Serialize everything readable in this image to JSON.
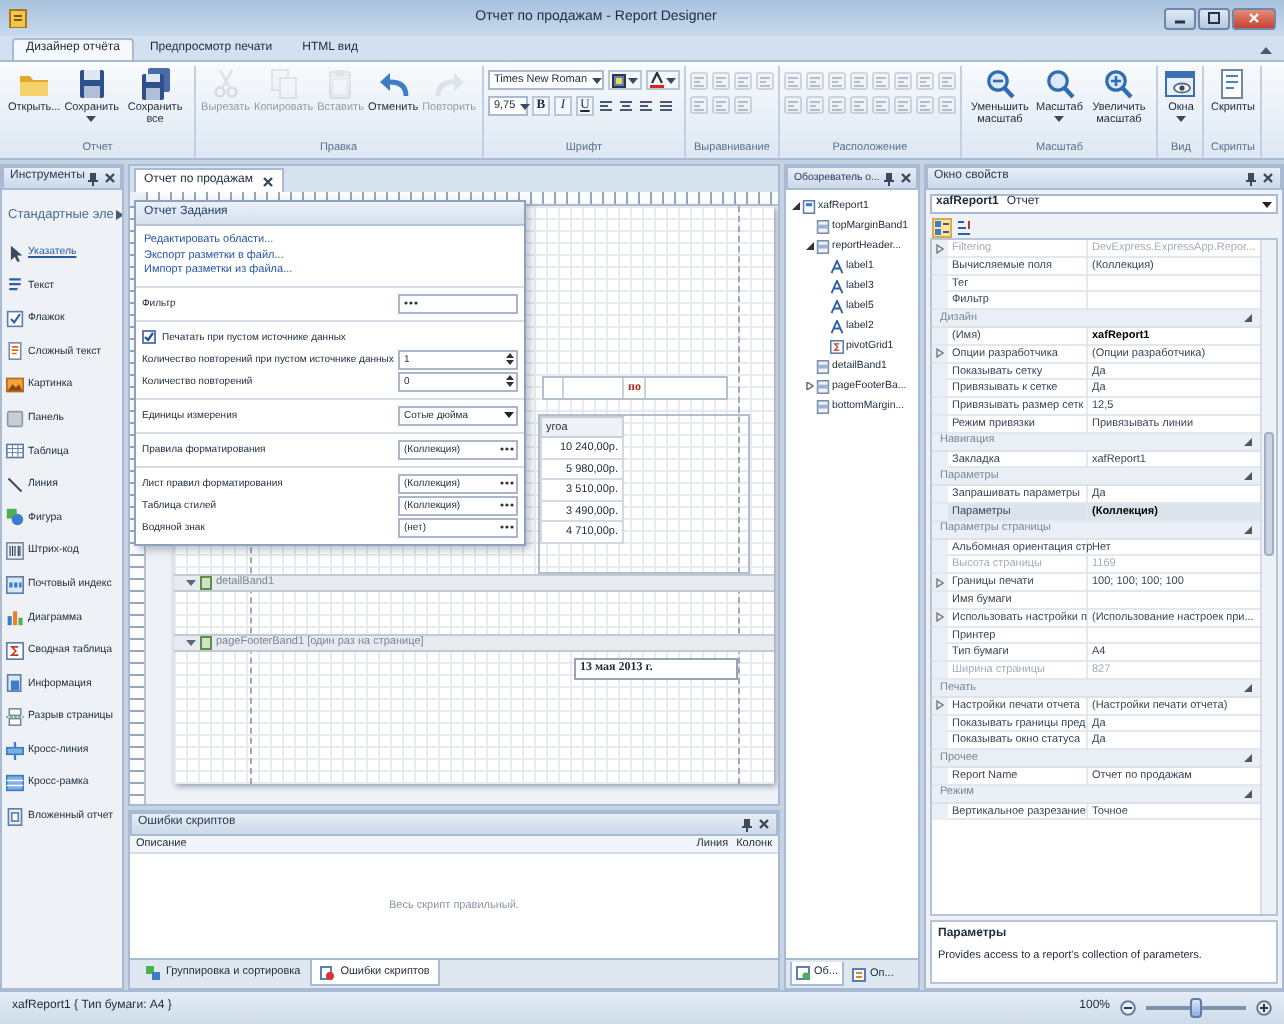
{
  "window": {
    "title": "Отчет по продажам - Report Designer"
  },
  "ribbon": {
    "tabs": [
      {
        "label": "Дизайнер отчёта",
        "selected": true
      },
      {
        "label": "Предпросмотр печати",
        "selected": false
      },
      {
        "label": "HTML вид",
        "selected": false
      }
    ],
    "groups": [
      {
        "label": "Отчет",
        "kind": "buttons",
        "buttons": [
          {
            "label": "Открыть...",
            "disabled": false,
            "dropdown": false
          },
          {
            "label": "Сохранить",
            "disabled": false,
            "dropdown": true
          },
          {
            "label": "Сохранить все",
            "disabled": false,
            "dropdown": false
          }
        ]
      },
      {
        "label": "Правка",
        "kind": "buttons",
        "buttons": [
          {
            "label": "Вырезать",
            "disabled": true,
            "dropdown": false
          },
          {
            "label": "Копировать",
            "disabled": true,
            "dropdown": false
          },
          {
            "label": "Вставить",
            "disabled": true,
            "dropdown": false
          },
          {
            "label": "Отменить",
            "disabled": false,
            "dropdown": false
          },
          {
            "label": "Повторить",
            "disabled": true,
            "dropdown": false
          }
        ]
      },
      {
        "label": "Шрифт",
        "kind": "font",
        "font": "Times New Roman",
        "size": "9,75",
        "styles": [
          "B",
          "I",
          "U"
        ]
      },
      {
        "label": "Выравнивание",
        "kind": "icons",
        "disabled": true
      },
      {
        "label": "Расположение",
        "kind": "icons",
        "disabled": true
      },
      {
        "label": "Масштаб",
        "kind": "buttons",
        "buttons": [
          {
            "label": "Уменьшить масштаб",
            "disabled": false,
            "dropdown": false
          },
          {
            "label": "Масштаб",
            "disabled": false,
            "dropdown": true
          },
          {
            "label": "Увеличить масштаб",
            "disabled": false,
            "dropdown": false
          }
        ]
      },
      {
        "label": "Вид",
        "kind": "buttons",
        "buttons": [
          {
            "label": "Окна",
            "disabled": false,
            "dropdown": true
          }
        ]
      },
      {
        "label": "Скрипты",
        "kind": "buttons",
        "buttons": [
          {
            "label": "Скрипты",
            "disabled": false,
            "dropdown": false
          }
        ]
      }
    ]
  },
  "toolbox": {
    "title": "Инструменты",
    "section": "Стандартные эле",
    "items": [
      {
        "label": "Указатель",
        "selected": true
      },
      {
        "label": "Текст",
        "selected": false
      },
      {
        "label": "Флажок",
        "selected": false
      },
      {
        "label": "Сложный текст",
        "selected": false
      },
      {
        "label": "Картинка",
        "selected": false
      },
      {
        "label": "Панель",
        "selected": false
      },
      {
        "label": "Таблица",
        "selected": false
      },
      {
        "label": "Линия",
        "selected": false
      },
      {
        "label": "Фигура",
        "selected": false
      },
      {
        "label": "Штрих-код",
        "selected": false
      },
      {
        "label": "Почтовый индекс",
        "selected": false
      },
      {
        "label": "Диаграмма",
        "selected": false
      },
      {
        "label": "Сводная таблица",
        "selected": false
      },
      {
        "label": "Информация",
        "selected": false
      },
      {
        "label": "Разрыв страницы",
        "selected": false
      },
      {
        "label": "Кросс-линия",
        "selected": false
      },
      {
        "label": "Кросс-рамка",
        "selected": false
      },
      {
        "label": "Вложенный отчет",
        "selected": false
      }
    ]
  },
  "designer": {
    "tab": "Отчет по продажам",
    "smart_tag": {
      "title": "Отчет Задания",
      "links": [
        "Редактировать области...",
        "Экспорт разметки в файл...",
        "Импорт разметки из файла..."
      ],
      "sections": [
        [
          {
            "kind": "ellipsis",
            "label": "Фильтр"
          }
        ],
        [
          {
            "kind": "check",
            "label": "Печатать при пустом источнике данных",
            "checked": true
          },
          {
            "kind": "spin",
            "label": "Количество повторений при пустом источнике данных",
            "value": "1"
          },
          {
            "kind": "spin",
            "label": "Количество повторений",
            "value": "0"
          }
        ],
        [
          {
            "kind": "combo",
            "label": "Единицы измерения",
            "value": "Сотые дюйма"
          }
        ],
        [
          {
            "kind": "ellipsis",
            "label": "Правила форматирования",
            "value": "(Коллекция)"
          }
        ],
        [
          {
            "kind": "ellipsis",
            "label": "Лист правил форматирования",
            "value": "(Коллекция)"
          },
          {
            "kind": "ellipsis",
            "label": "Таблица стилей",
            "value": "(Коллекция)"
          },
          {
            "kind": "ellipsis",
            "label": "Водяной знак",
            "value": "(нет)"
          }
        ]
      ]
    },
    "report": {
      "header_cell": "по",
      "table": {
        "column_1": "угоа",
        "values": [
          "10 240,00р.",
          "5 980,00р.",
          "3 510,00р.",
          "3 490,00р.",
          "4 710,00р."
        ]
      },
      "bands": [
        {
          "label": "detailBand1"
        },
        {
          "label": "pageFooterBand1 [один раз на странице]"
        }
      ],
      "date": "13 мая 2013 г."
    }
  },
  "errors": {
    "title": "Ошибки скриптов",
    "columns": [
      "Описание",
      "Линия",
      "Колонк"
    ],
    "message": "Весь скрипт правильный.",
    "tabs": [
      {
        "label": "Группировка и сортировка",
        "selected": false
      },
      {
        "label": "Ошибки скриптов",
        "selected": true
      }
    ]
  },
  "explorer": {
    "title": "Обозреватель о...",
    "tree": [
      {
        "label": "xafReport1",
        "kind": "report",
        "expanded": true,
        "children": [
          {
            "label": "topMarginBand1",
            "kind": "band"
          },
          {
            "label": "reportHeader...",
            "kind": "band",
            "expanded": true,
            "children": [
              {
                "label": "label1",
                "kind": "label"
              },
              {
                "label": "label3",
                "kind": "label"
              },
              {
                "label": "label5",
                "kind": "label"
              },
              {
                "label": "label2",
                "kind": "label"
              },
              {
                "label": "pivotGrid1",
                "kind": "pivot"
              }
            ]
          },
          {
            "label": "detailBand1",
            "kind": "band"
          },
          {
            "label": "pageFooterBa...",
            "kind": "band",
            "expanded": false
          },
          {
            "label": "bottomMargin...",
            "kind": "band"
          }
        ]
      }
    ],
    "tabs": [
      {
        "label": "Об...",
        "selected": true
      },
      {
        "label": "Оп...",
        "selected": false
      }
    ]
  },
  "properties": {
    "title": "Окно свойств",
    "object": {
      "name": "xafReport1",
      "type": "Отчет"
    },
    "sort_buttons": [
      {
        "selected": true
      },
      {
        "selected": false
      }
    ],
    "sections": [
      {
        "rows": [
          {
            "name": "Filtering",
            "value": "DevExpress.ExpressApp.Repor...",
            "expandable": true,
            "disabled": true,
            "modified": false,
            "selected": false
          },
          {
            "name": "Вычисляемые поля",
            "value": "(Коллекция)",
            "expandable": false,
            "disabled": false,
            "modified": false,
            "selected": false
          },
          {
            "name": "Тег",
            "expandable": false,
            "disabled": false,
            "selected": false
          },
          {
            "name": "Фильтр",
            "expandable": false,
            "disabled": false,
            "selected": false
          }
        ]
      },
      {
        "category": "Дизайн",
        "rows": [
          {
            "name": "(Имя)",
            "value": "xafReport1",
            "expandable": false,
            "disabled": false,
            "modified": true,
            "selected": false
          },
          {
            "name": "Опции разработчика",
            "value": "(Опции разработчика)",
            "expandable": true,
            "disabled": false,
            "modified": false,
            "selected": false
          },
          {
            "name": "Показывать сетку",
            "value": "Да",
            "expandable": false,
            "disabled": false,
            "modified": false,
            "selected": false
          },
          {
            "name": "Привязывать к сетке",
            "value": "Да",
            "expandable": false,
            "disabled": false,
            "modified": false,
            "selected": false
          },
          {
            "name": "Привязывать размер сетк",
            "value": "12,5",
            "expandable": false,
            "disabled": false,
            "modified": false,
            "selected": false
          },
          {
            "name": "Режим привязки",
            "value": "Привязывать линии",
            "expandable": false,
            "disabled": false,
            "modified": false,
            "selected": false
          }
        ]
      },
      {
        "category": "Навигация",
        "rows": [
          {
            "name": "Закладка",
            "value": "xafReport1",
            "expandable": false,
            "disabled": false,
            "modified": false,
            "selected": false
          }
        ]
      },
      {
        "category": "Параметры",
        "rows": [
          {
            "name": "Запрашивать параметры",
            "value": "Да",
            "expandable": false,
            "disabled": false,
            "modified": false,
            "selected": false
          },
          {
            "name": "Параметры",
            "value": "(Коллекция)",
            "expandable": false,
            "disabled": false,
            "modified": true,
            "selected": true
          }
        ]
      },
      {
        "category": "Параметры страницы",
        "rows": [
          {
            "name": "Альбомная ориентация стр",
            "value": "Нет",
            "expandable": false,
            "disabled": false,
            "modified": false,
            "selected": false
          },
          {
            "name": "Высота страницы",
            "value": "1169",
            "expandable": false,
            "disabled": true,
            "modified": false,
            "selected": false
          },
          {
            "name": "Границы печати",
            "value": "100; 100; 100; 100",
            "expandable": true,
            "disabled": false,
            "modified": false,
            "selected": false
          },
          {
            "name": "Имя бумаги",
            "expandable": false,
            "disabled": false,
            "selected": false
          },
          {
            "name": "Использовать настройки п",
            "value": "(Использование настроек при...",
            "expandable": true,
            "disabled": false,
            "modified": false,
            "selected": false
          },
          {
            "name": "Принтер",
            "expandable": false,
            "disabled": false,
            "selected": false
          },
          {
            "name": "Тип бумаги",
            "value": "A4",
            "expandable": false,
            "disabled": false,
            "modified": false,
            "selected": false
          },
          {
            "name": "Ширина страницы",
            "value": "827",
            "expandable": false,
            "disabled": true,
            "modified": false,
            "selected": false
          }
        ]
      },
      {
        "category": "Печать",
        "rows": [
          {
            "name": "Настройки печати отчета",
            "value": "(Настройки печати отчета)",
            "expandable": true,
            "disabled": false,
            "modified": false,
            "selected": false
          },
          {
            "name": "Показывать границы пред",
            "value": "Да",
            "expandable": false,
            "disabled": false,
            "modified": false,
            "selected": false
          },
          {
            "name": "Показывать окно статуса",
            "value": "Да",
            "expandable": false,
            "disabled": false,
            "modified": false,
            "selected": false
          }
        ]
      },
      {
        "category": "Прочее",
        "rows": [
          {
            "name": "Report Name",
            "value": "Отчет по продажам",
            "expandable": false,
            "disabled": false,
            "modified": false,
            "selected": false
          }
        ]
      },
      {
        "category": "Режим",
        "rows": [
          {
            "name": "Вертикальное разрезание",
            "value": "Точное",
            "expandable": false,
            "disabled": false,
            "modified": false,
            "selected": false
          }
        ]
      }
    ],
    "description": {
      "title": "Параметры",
      "text": "Provides access to a report's collection of parameters."
    }
  },
  "status_bar": {
    "text": "xafReport1 { Тип бумаги: А4 }",
    "zoom": "100%",
    "level": 0.5
  }
}
